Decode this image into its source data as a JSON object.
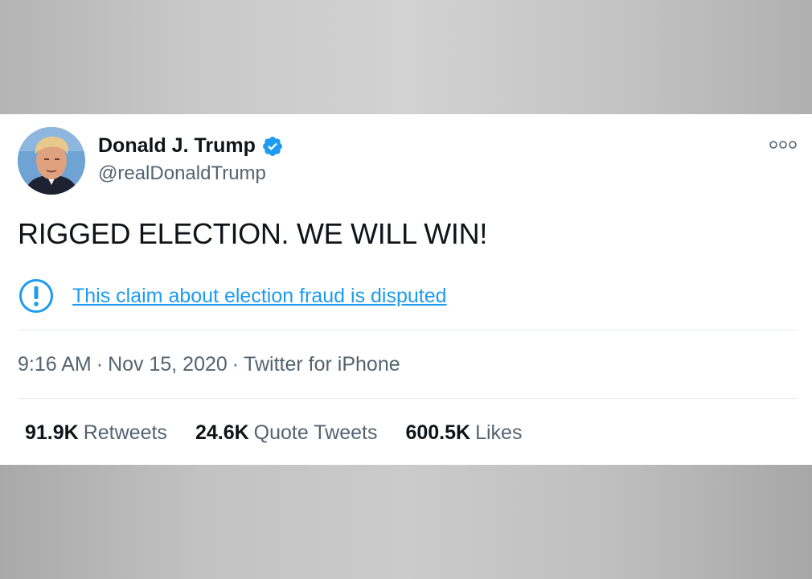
{
  "tweet": {
    "author": {
      "display_name": "Donald J. Trump",
      "handle": "@realDonaldTrump",
      "verified": true,
      "avatar": "profile-photo"
    },
    "text": "RIGGED ELECTION. WE WILL WIN!",
    "notice": {
      "icon": "exclamation-circle-icon",
      "text": "This claim about election fraud is disputed"
    },
    "meta": {
      "time": "9:16 AM",
      "separator": "·",
      "date": "Nov 15, 2020",
      "source": "Twitter for iPhone"
    },
    "stats": [
      {
        "value": "91.9K",
        "label": "Retweets"
      },
      {
        "value": "24.6K",
        "label": "Quote Tweets"
      },
      {
        "value": "600.5K",
        "label": "Likes"
      }
    ]
  },
  "colors": {
    "accent": "#1d9bf0",
    "text_primary": "#0f1419",
    "text_secondary": "#536471",
    "divider": "#e6ecf0"
  }
}
